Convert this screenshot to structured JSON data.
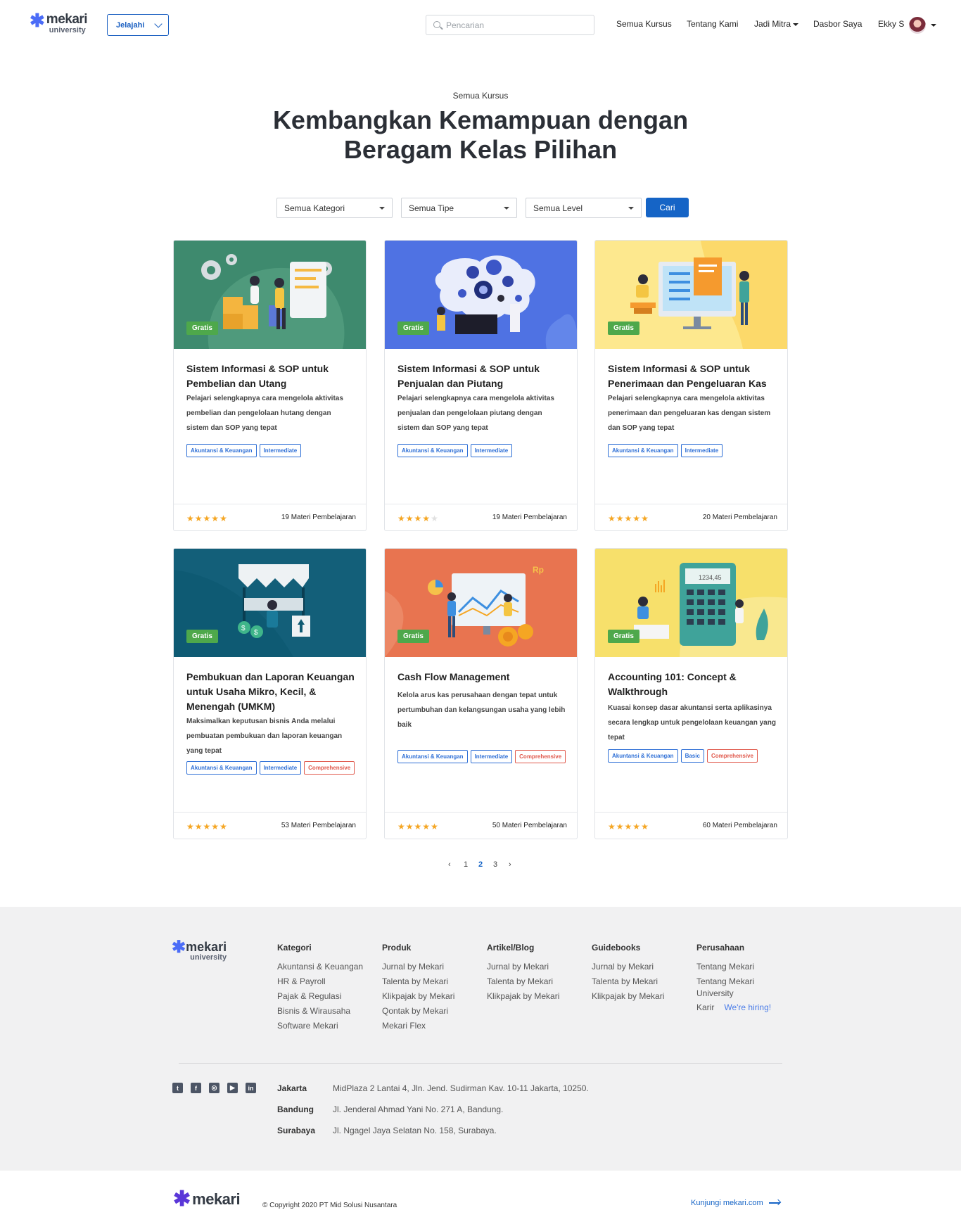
{
  "header": {
    "logo_word": "mekari",
    "logo_sub": "university",
    "explore_label": "Jelajahi",
    "search_placeholder": "Pencarian",
    "nav": {
      "all_courses": "Semua Kursus",
      "about": "Tentang Kami",
      "partner": "Jadi Mitra",
      "dashboard": "Dasbor Saya",
      "user": "Ekky S"
    }
  },
  "hero": {
    "eyebrow": "Semua Kursus",
    "title_line1": "Kembangkan Kemampuan dengan",
    "title_line2": "Beragam Kelas Pilihan"
  },
  "filters": {
    "category": "Semua Kategori",
    "type": "Semua Tipe",
    "level": "Semua Level",
    "search_button": "Cari"
  },
  "courses": [
    {
      "badge": "Gratis",
      "title": "Sistem Informasi & SOP untuk Pembelian dan Utang",
      "desc": "Pelajari selengkapnya cara mengelola aktivitas pembelian dan pengelolaan hutang dengan sistem dan SOP yang tepat",
      "tag1": "Akuntansi & Keuangan",
      "tag2": "Intermediate",
      "tag3": "",
      "rating": 5,
      "materials": "19 Materi Pembelajaran",
      "bg": "#3e8a6e"
    },
    {
      "badge": "Gratis",
      "title": "Sistem Informasi & SOP untuk Penjualan dan Piutang",
      "desc": "Pelajari selengkapnya cara mengelola aktivitas penjualan dan pengelolaan piutang dengan sistem dan SOP yang tepat",
      "tag1": "Akuntansi & Keuangan",
      "tag2": "Intermediate",
      "tag3": "",
      "rating": 4,
      "materials": "19 Materi Pembelajaran",
      "bg": "#4f72e3"
    },
    {
      "badge": "Gratis",
      "title": "Sistem Informasi & SOP untuk Penerimaan dan Pengeluaran Kas",
      "desc": "Pelajari selengkapnya cara mengelola aktivitas penerimaan dan pengeluaran kas dengan sistem dan SOP yang tepat",
      "tag1": "Akuntansi & Keuangan",
      "tag2": "Intermediate",
      "tag3": "",
      "rating": 5,
      "materials": "20 Materi Pembelajaran",
      "bg": "#fde88e"
    },
    {
      "badge": "Gratis",
      "title": "Pembukuan dan Laporan Keuangan untuk Usaha Mikro, Kecil, & Menengah (UMKM)",
      "desc": "Maksimalkan keputusan bisnis Anda melalui pembuatan pembukuan dan laporan keuangan yang tepat",
      "tag1": "Akuntansi & Keuangan",
      "tag2": "Intermediate",
      "tag3": "Comprehensive",
      "rating": 5,
      "materials": "53 Materi Pembelajaran",
      "bg": "#0e5a73"
    },
    {
      "badge": "Gratis",
      "title": "Cash Flow Management",
      "desc": "Kelola arus kas perusahaan dengan tepat untuk pertumbuhan dan kelangsungan usaha yang lebih baik",
      "tag1": "Akuntansi & Keuangan",
      "tag2": "Intermediate",
      "tag3": "Comprehensive",
      "rating": 5,
      "materials": "50 Materi Pembelajaran",
      "bg": "#e87450"
    },
    {
      "badge": "Gratis",
      "title": "Accounting 101: Concept & Walkthrough",
      "desc": "Kuasai konsep dasar akuntansi serta aplikasinya secara lengkap untuk pengelolaan keuangan yang tepat",
      "tag1": "Akuntansi & Keuangan",
      "tag2": "Basic",
      "tag3": "Comprehensive",
      "rating": 5,
      "materials": "60 Materi Pembelajaran",
      "bg": "#f7e06b",
      "calc_display": "1234,45"
    }
  ],
  "pagination": {
    "prev": "‹",
    "pages": [
      "1",
      "2",
      "3"
    ],
    "current": "2",
    "next": "›"
  },
  "footer": {
    "columns": [
      {
        "title": "Kategori",
        "items": [
          "Akuntansi & Keuangan",
          "HR & Payroll",
          "Pajak & Regulasi",
          "Bisnis & Wirausaha",
          "Software Mekari"
        ]
      },
      {
        "title": "Produk",
        "items": [
          "Jurnal by Mekari",
          "Talenta by Mekari",
          "Klikpajak by Mekari",
          "Qontak by Mekari",
          "Mekari Flex"
        ]
      },
      {
        "title": "Artikel/Blog",
        "items": [
          "Jurnal by Mekari",
          "Talenta by Mekari",
          "Klikpajak by Mekari"
        ]
      },
      {
        "title": "Guidebooks",
        "items": [
          "Jurnal by Mekari",
          "Talenta by Mekari",
          "Klikpajak by Mekari"
        ]
      },
      {
        "title": "Perusahaan",
        "items": [
          "Tentang Mekari",
          "Tentang Mekari University",
          "Karir"
        ],
        "hiring": "We're hiring!"
      }
    ],
    "social": [
      "twitter-icon",
      "facebook-icon",
      "instagram-icon",
      "youtube-icon",
      "linkedin-icon"
    ],
    "offices": [
      {
        "city": "Jakarta",
        "address": "MidPlaza 2 Lantai 4, Jln. Jend. Sudirman Kav. 10-11 Jakarta, 10250."
      },
      {
        "city": "Bandung",
        "address": "Jl. Jenderal Ahmad Yani No. 271 A, Bandung."
      },
      {
        "city": "Surabaya",
        "address": "Jl. Ngagel Jaya Selatan No. 158, Surabaya."
      }
    ],
    "bottom_logo": "mekari",
    "copyright": "© Copyright 2020 PT Mid Solusi Nusantara",
    "visit": "Kunjungi mekari.com"
  }
}
